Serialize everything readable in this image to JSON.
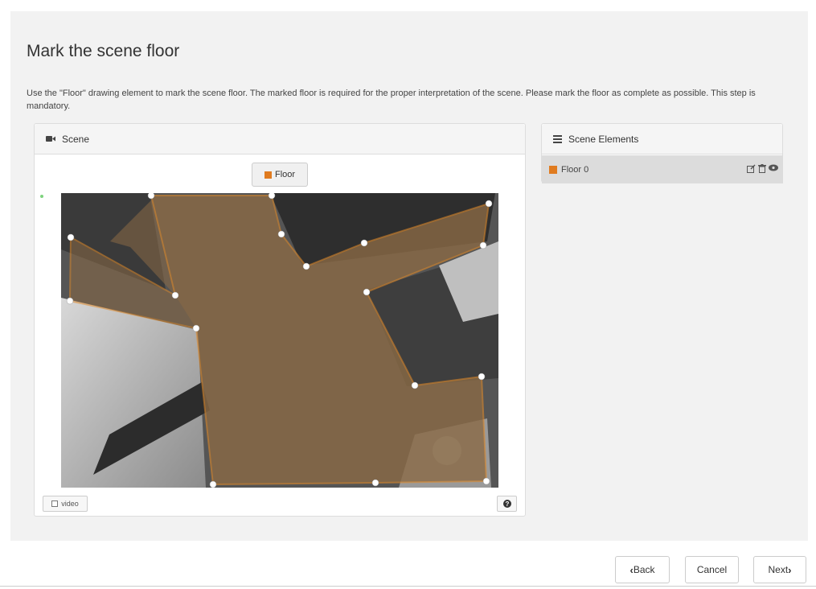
{
  "page": {
    "title": "Mark the scene floor",
    "instructions": "Use the \"Floor\" drawing element to mark the scene floor. The marked floor is required for the proper interpretation of the scene. Please mark the floor as complete as possible. This step is mandatory."
  },
  "scene_panel": {
    "heading": "Scene",
    "heading_icon": "video-camera-icon",
    "tool_button_label": "Floor",
    "video_toggle_label": "video",
    "help_icon": "question-circle-icon"
  },
  "elements_panel": {
    "heading": "Scene Elements",
    "heading_icon": "list-icon",
    "items": [
      {
        "label": "Floor 0",
        "actions": [
          "edit-icon",
          "trash-icon",
          "eye-icon"
        ]
      }
    ]
  },
  "footer": {
    "back_label": "Back",
    "cancel_label": "Cancel",
    "next_label": "Next"
  },
  "colors": {
    "floor_accent": "#e07b1f",
    "panel_background": "#f2f2f2"
  }
}
